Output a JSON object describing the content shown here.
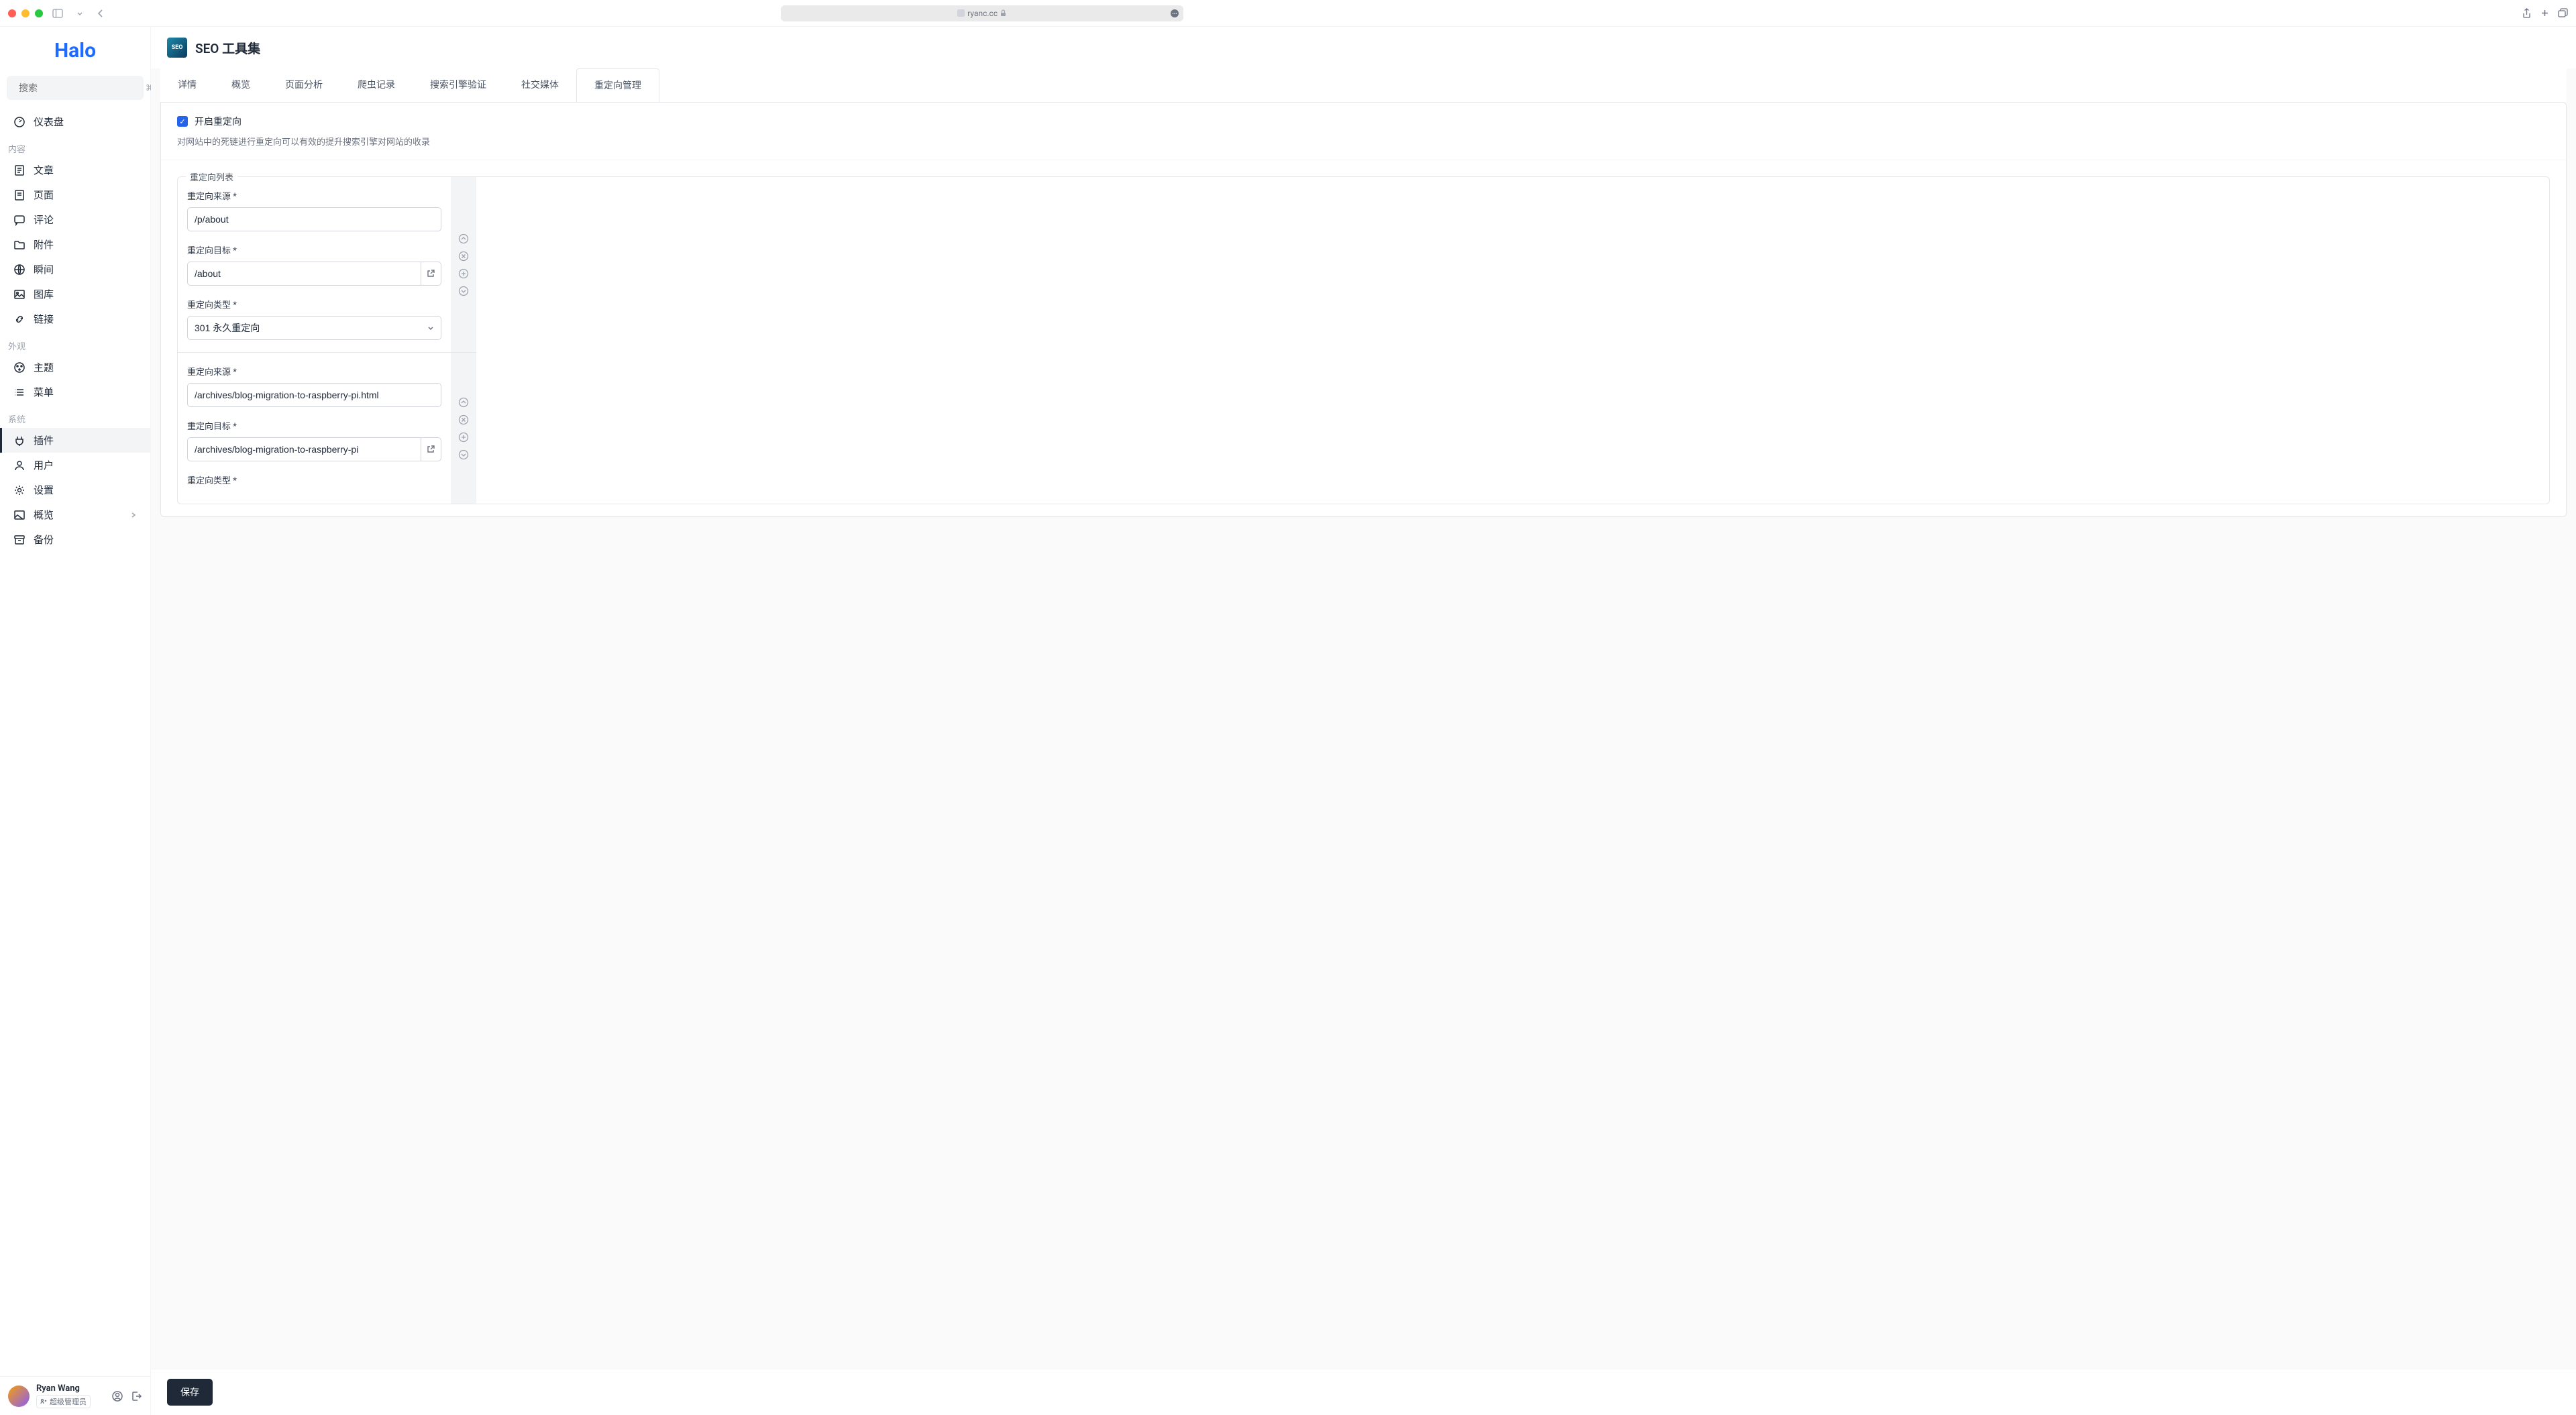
{
  "browser": {
    "url": "ryanc.cc"
  },
  "sidebar": {
    "search_placeholder": "搜索",
    "shortcut": "⌘+K",
    "sections": {
      "content": "内容",
      "appearance": "外观",
      "system": "系统"
    },
    "items": {
      "dashboard": "仪表盘",
      "posts": "文章",
      "pages": "页面",
      "comments": "评论",
      "attachments": "附件",
      "moments": "瞬间",
      "photos": "图库",
      "links": "链接",
      "themes": "主题",
      "menus": "菜单",
      "plugins": "插件",
      "users": "用户",
      "settings": "设置",
      "overview": "概览",
      "backup": "备份"
    }
  },
  "user": {
    "name": "Ryan Wang",
    "role": "超级管理员"
  },
  "header": {
    "plugin_code": "SEO",
    "title": "SEO 工具集"
  },
  "tabs": {
    "detail": "详情",
    "overview": "概览",
    "page_analysis": "页面分析",
    "crawler": "爬虫记录",
    "verification": "搜索引擎验证",
    "social": "社交媒体",
    "redirect": "重定向管理"
  },
  "panel": {
    "enable_label": "开启重定向",
    "help_text": "对网站中的死链进行重定向可以有效的提升搜索引擎对网站的收录",
    "list_legend": "重定向列表",
    "source_label": "重定向来源 ",
    "target_label": "重定向目标 ",
    "type_label": "重定向类型 ",
    "required": "*",
    "type_value": "301 永久重定向",
    "redirects": [
      {
        "source": "/p/about",
        "target": "/about"
      },
      {
        "source": "/archives/blog-migration-to-raspberry-pi.html",
        "target": "/archives/blog-migration-to-raspberry-pi"
      }
    ]
  },
  "footer": {
    "save": "保存"
  }
}
